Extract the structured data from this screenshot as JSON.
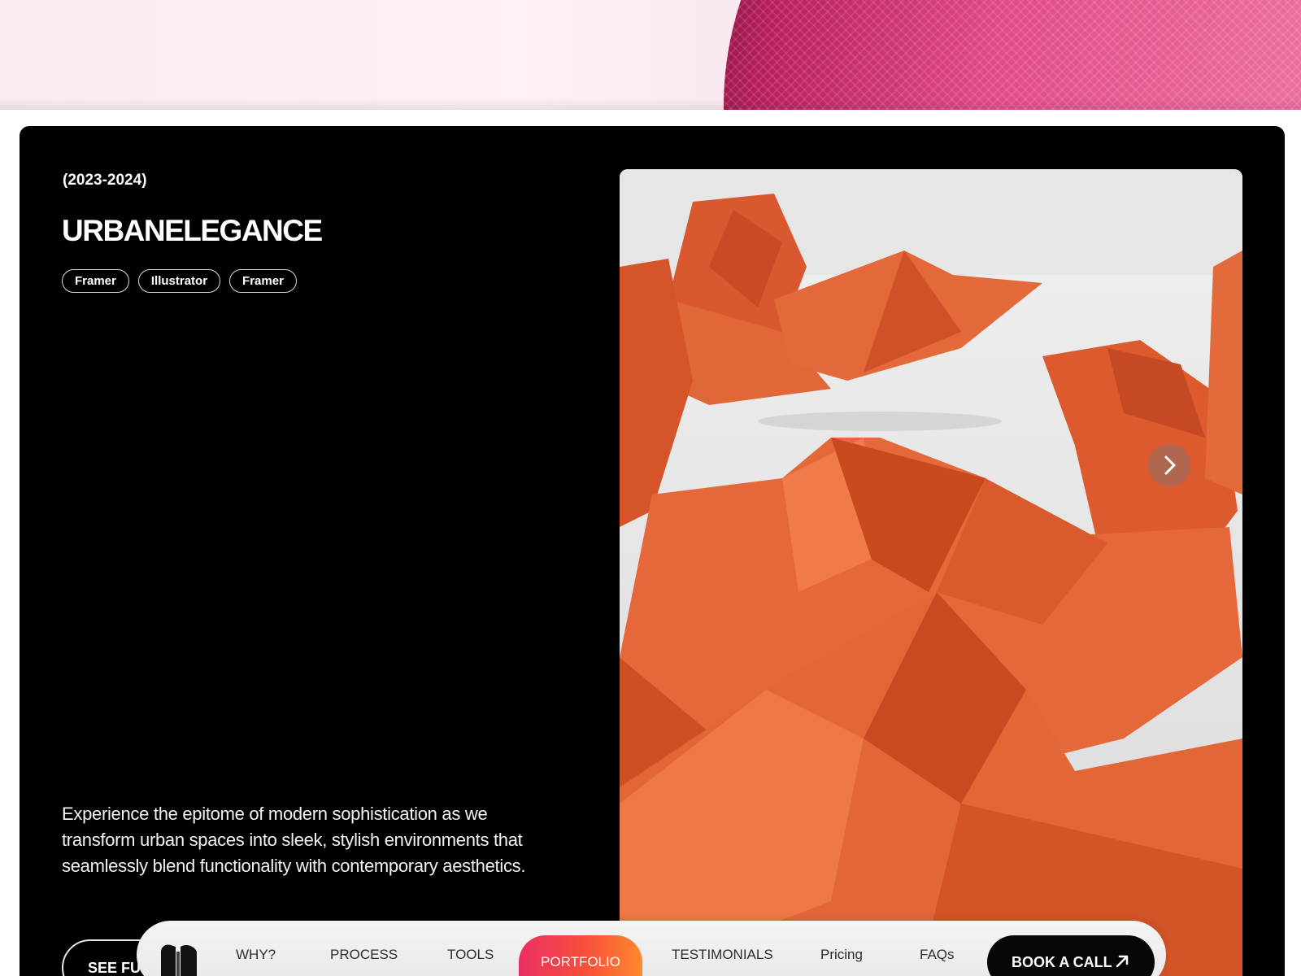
{
  "project": {
    "years": "(2023-2024)",
    "title": "URBANELEGANCE",
    "tags": [
      "Framer",
      "Illustrator",
      "Framer"
    ],
    "description": "Experience the epitome of modern sophistication as we transform urban spaces into sleek, stylish environments that seamlessly blend functionality with contemporary aesthetics.",
    "see_full_label": "SEE FU"
  },
  "image": {
    "icon": "origami-swans-photo",
    "next_icon": "chevron-right-icon"
  },
  "nav": {
    "logo_icon": "logo-icon",
    "items": [
      "WHY?",
      "PROCESS",
      "TOOLS",
      "PORTFOLIO",
      "TESTIMONIALS",
      "Pricing",
      "FAQs"
    ],
    "active": "PORTFOLIO",
    "cta_label": "BOOK A CALL",
    "cta_icon": "arrow-up-right-icon"
  },
  "colors": {
    "accent_start": "#ec2f62",
    "accent_end": "#ff8a2c",
    "card_bg": "#000000",
    "banner_accent": "#b81e5b"
  }
}
